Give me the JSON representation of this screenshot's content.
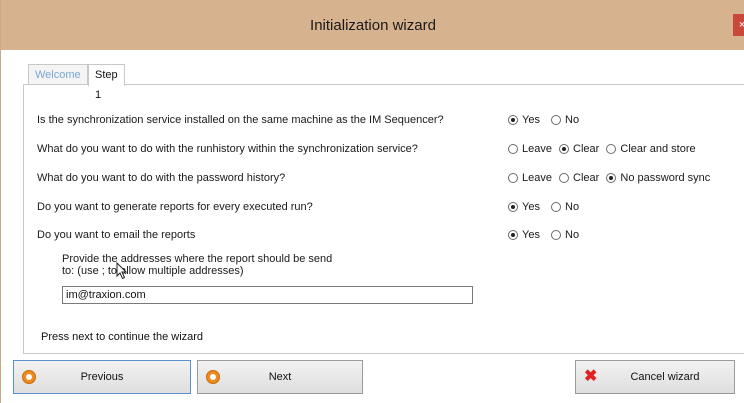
{
  "window": {
    "title": "Initialization wizard",
    "close": "×"
  },
  "tabs": [
    {
      "label": "Welcome",
      "active": false
    },
    {
      "label": "Step 1",
      "active": true
    }
  ],
  "questions": [
    {
      "text": "Is the synchronization service installed on the same machine as the IM Sequencer?",
      "options": [
        {
          "label": "Yes",
          "checked": true
        },
        {
          "label": "No",
          "checked": false
        }
      ]
    },
    {
      "text": "What do you want to do with the runhistory within the synchronization service?",
      "options": [
        {
          "label": "Leave",
          "checked": false
        },
        {
          "label": "Clear",
          "checked": true
        },
        {
          "label": "Clear and store",
          "checked": false
        }
      ]
    },
    {
      "text": "What do you want to do with the password history?",
      "options": [
        {
          "label": "Leave",
          "checked": false
        },
        {
          "label": "Clear",
          "checked": false
        },
        {
          "label": "No password sync",
          "checked": true
        }
      ]
    },
    {
      "text": "Do you want to generate reports for every executed run?",
      "options": [
        {
          "label": "Yes",
          "checked": true
        },
        {
          "label": "No",
          "checked": false
        }
      ]
    },
    {
      "text": "Do you want to email the reports",
      "options": [
        {
          "label": "Yes",
          "checked": true
        },
        {
          "label": "No",
          "checked": false
        }
      ]
    }
  ],
  "email": {
    "note_line1": "Provide the addresses where the report should be send",
    "note_line2": "to: (use ; to allow multiple addresses)",
    "value": "im@traxion.com"
  },
  "footer_text": "Press next to continue the wizard",
  "buttons": {
    "previous": "Previous",
    "next": "Next",
    "cancel": "Cancel wizard"
  }
}
